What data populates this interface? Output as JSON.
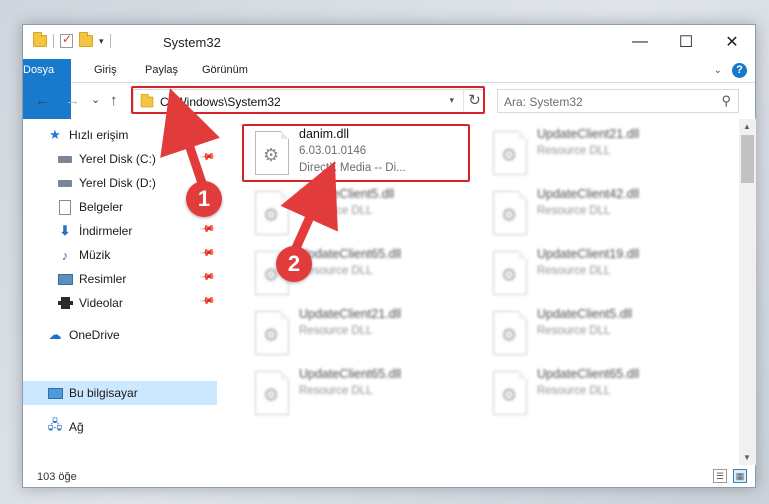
{
  "window": {
    "title": "System32",
    "controls": {
      "minimize": "—",
      "maximize": "☐",
      "close": "✕"
    }
  },
  "ribbon": {
    "tabs": [
      "Dosya",
      "Giriş",
      "Paylaş",
      "Görünüm"
    ],
    "help": "?"
  },
  "nav": {
    "back": "←",
    "forward": "→",
    "recent": "⌄",
    "up": "↑",
    "address": "C:\\Windows\\System32",
    "refresh": "↻",
    "search_placeholder": "Ara: System32"
  },
  "sidebar": {
    "items": [
      {
        "label": "Hızlı erişim",
        "icon": "star-icon",
        "pinned": false
      },
      {
        "label": "Yerel Disk (C:)",
        "icon": "drive-icon",
        "pinned": true
      },
      {
        "label": "Yerel Disk (D:)",
        "icon": "drive-icon",
        "pinned": true
      },
      {
        "label": "Belgeler",
        "icon": "documents-icon",
        "pinned": true
      },
      {
        "label": "İndirmeler",
        "icon": "downloads-icon",
        "pinned": true
      },
      {
        "label": "Müzik",
        "icon": "music-icon",
        "pinned": true
      },
      {
        "label": "Resimler",
        "icon": "pictures-icon",
        "pinned": true
      },
      {
        "label": "Videolar",
        "icon": "videos-icon",
        "pinned": true
      },
      {
        "label": "OneDrive",
        "icon": "onedrive-icon",
        "pinned": false
      },
      {
        "label": "Bu bilgisayar",
        "icon": "this-pc-icon",
        "pinned": false,
        "selected": true
      },
      {
        "label": "Ağ",
        "icon": "network-icon",
        "pinned": false
      }
    ]
  },
  "files": [
    {
      "name": "danim.dll",
      "line2": "6.03.01.0146",
      "line3": "DirectX Media -- Di..."
    },
    {
      "name": "UpdateClient21.dll",
      "line2": "Resource DLL"
    },
    {
      "name": "UpdateClient5.dll",
      "line2": "Resource DLL"
    },
    {
      "name": "UpdateClient42.dll",
      "line2": "Resource DLL"
    },
    {
      "name": "UpdateClient65.dll",
      "line2": "Resource DLL"
    },
    {
      "name": "UpdateClient19.dll",
      "line2": "Resource DLL"
    },
    {
      "name": "UpdateClient21.dll",
      "line2": "Resource DLL"
    },
    {
      "name": "UpdateClient5.dll",
      "line2": "Resource DLL"
    },
    {
      "name": "UpdateClient65.dll",
      "line2": "Resource DLL"
    },
    {
      "name": "UpdateClient65.dll",
      "line2": "Resource DLL"
    }
  ],
  "status": {
    "count": "103 öğe"
  },
  "annotations": {
    "markers": [
      "1",
      "2"
    ],
    "color": "#d4232a"
  }
}
